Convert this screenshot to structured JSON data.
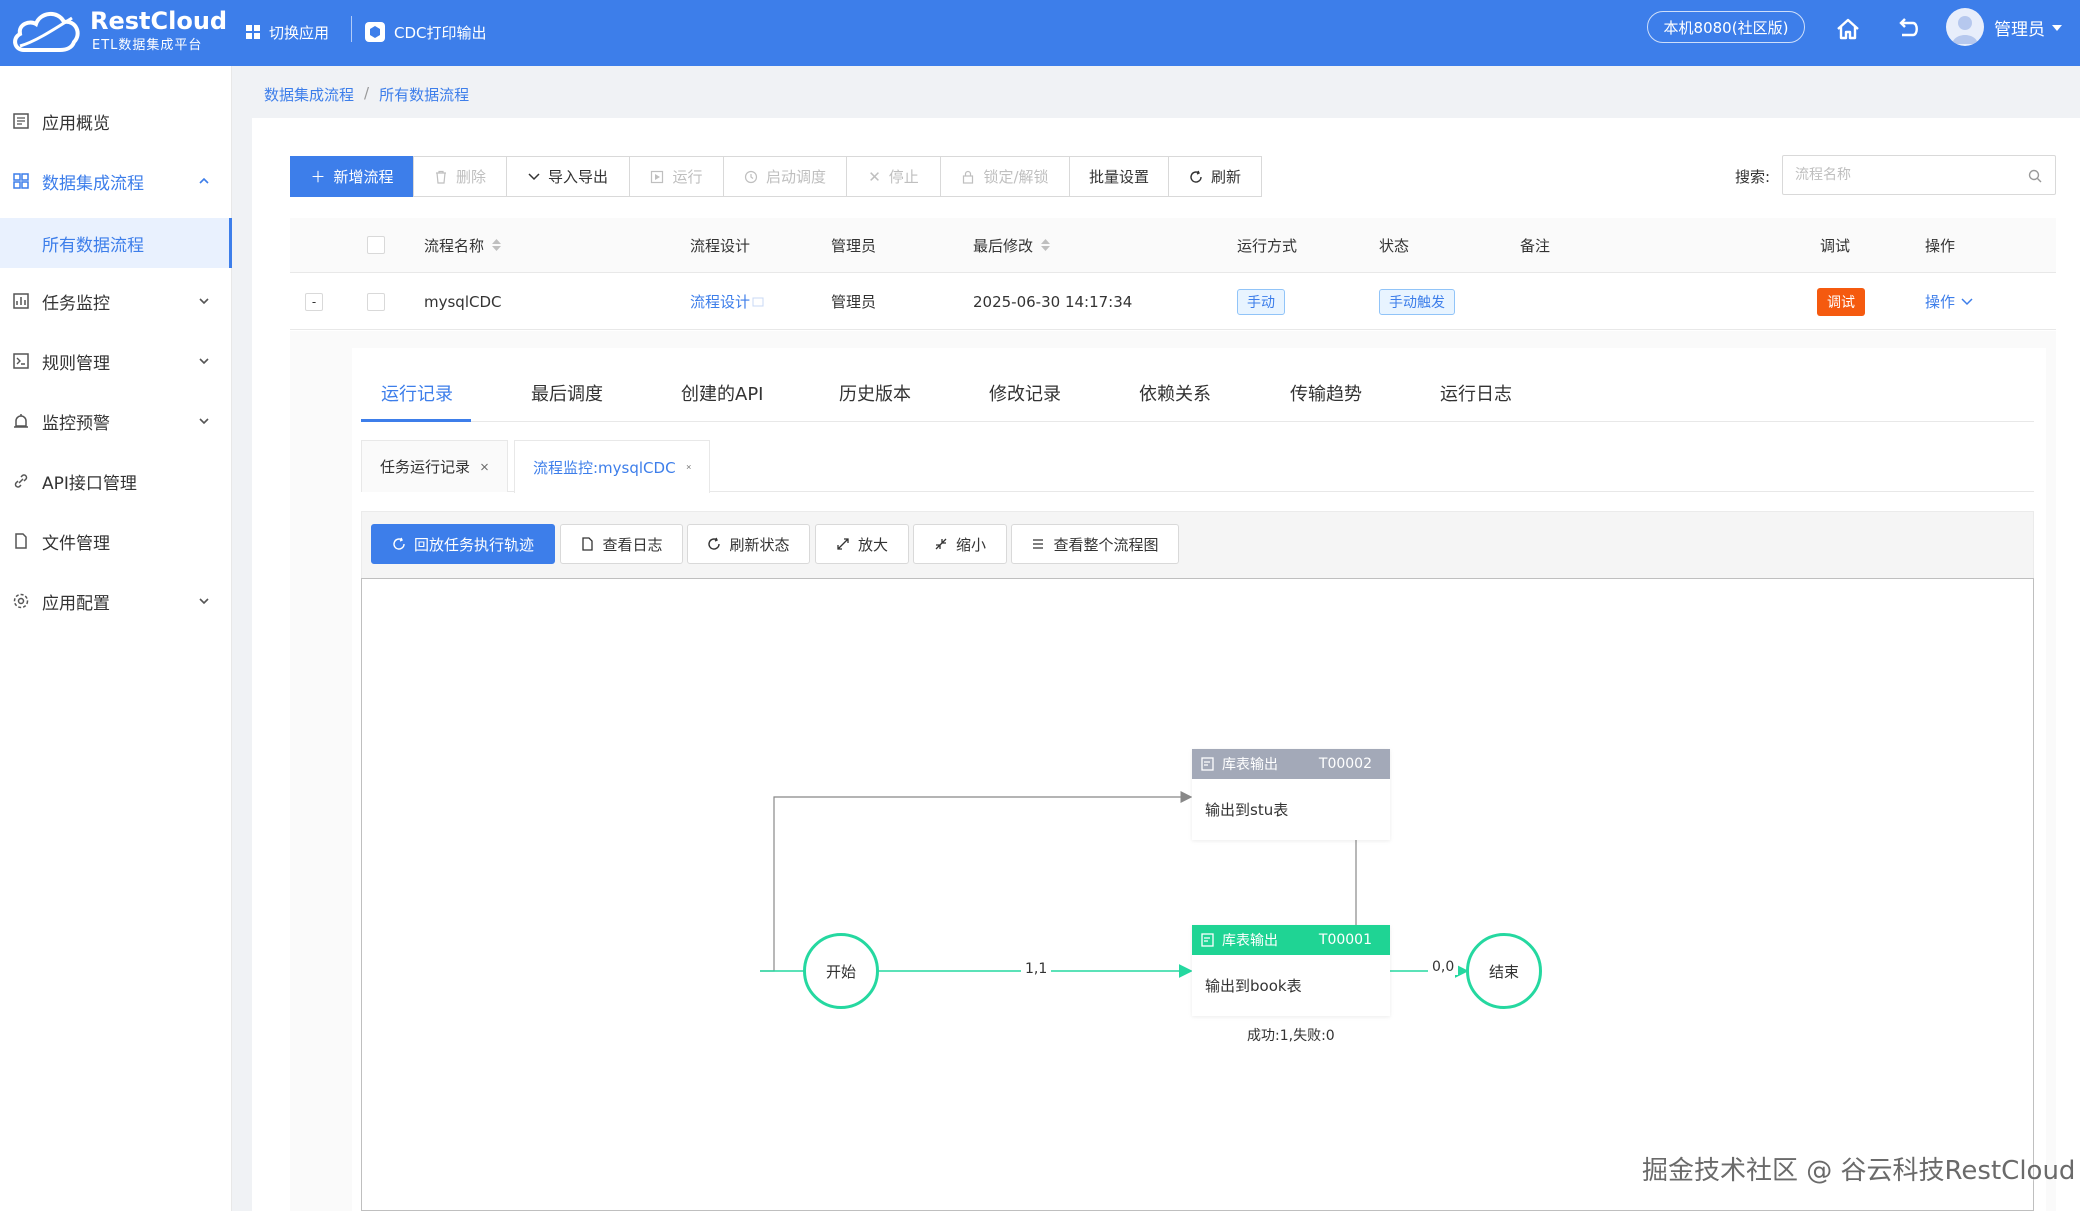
{
  "header": {
    "logo_name": "RestCloud",
    "logo_sub": "ETL数据集成平台",
    "switch_app": "切换应用",
    "current_app": "CDC打印输出",
    "env": "本机8080(社区版)",
    "user": "管理员"
  },
  "sidebar": {
    "items": [
      {
        "label": "应用概览",
        "icon": "overview-icon"
      },
      {
        "label": "数据集成流程",
        "icon": "grid-icon"
      },
      {
        "label": "所有数据流程"
      },
      {
        "label": "任务监控",
        "icon": "monitor-icon"
      },
      {
        "label": "规则管理",
        "icon": "rules-icon"
      },
      {
        "label": "监控预警",
        "icon": "alarm-icon"
      },
      {
        "label": "API接口管理",
        "icon": "link-icon"
      },
      {
        "label": "文件管理",
        "icon": "file-icon"
      },
      {
        "label": "应用配置",
        "icon": "gear-icon"
      }
    ]
  },
  "breadcrumb": {
    "items": [
      "数据集成流程",
      "所有数据流程"
    ],
    "separator": "/"
  },
  "toolbar": {
    "new_flow": "新增流程",
    "delete": "删除",
    "import_export": "导入导出",
    "run": "运行",
    "start_schedule": "启动调度",
    "stop": "停止",
    "lock_unlock": "锁定/解锁",
    "batch_settings": "批量设置",
    "refresh": "刷新"
  },
  "search": {
    "label": "搜索:",
    "placeholder": "流程名称"
  },
  "table": {
    "columns": [
      "流程名称",
      "流程设计",
      "管理员",
      "最后修改",
      "运行方式",
      "状态",
      "备注",
      "调试",
      "操作"
    ],
    "rows": [
      {
        "expander": "-",
        "name": "mysqlCDC",
        "design": "流程设计",
        "admin": "管理员",
        "modified": "2025-06-30 14:17:34",
        "run_mode": "手动",
        "status": "手动触发",
        "remark": "",
        "debug": "调试",
        "action": "操作"
      }
    ]
  },
  "tabs": [
    "运行记录",
    "最后调度",
    "创建的API",
    "历史版本",
    "修改记录",
    "依赖关系",
    "传输趋势",
    "运行日志"
  ],
  "active_tab": "运行记录",
  "subtabs": [
    "任务运行记录",
    "流程监控:mysqlCDC"
  ],
  "monitor_toolbar": {
    "replay": "回放任务执行轨迹",
    "view_log": "查看日志",
    "refresh_status": "刷新状态",
    "zoom_in": "放大",
    "zoom_out": "缩小",
    "view_all": "查看整个流程图"
  },
  "flow": {
    "start": "开始",
    "end": "结束",
    "node_stu": {
      "title": "库表输出",
      "code": "T00002",
      "body": "输出到stu表",
      "color": "#a3a9b8"
    },
    "node_book": {
      "title": "库表输出",
      "code": "T00001",
      "body": "输出到book表",
      "color": "#1fd494"
    },
    "edge_start_book": "1,1",
    "edge_book_end": "0,0",
    "book_stats": "成功:1,失败:0"
  },
  "watermark": "掘金技术社区 @ 谷云科技RestCloud",
  "colors": {
    "primary": "#3d7eea",
    "success": "#25d8a0",
    "danger": "#f55a0f"
  }
}
